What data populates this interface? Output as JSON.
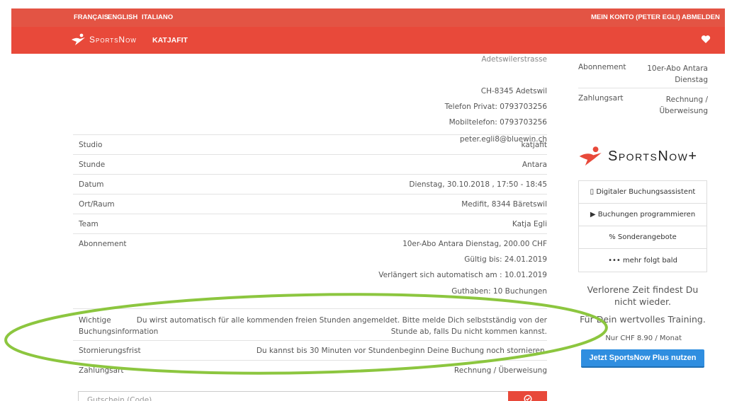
{
  "topbar": {
    "lang_fr": "FRANÇAIS",
    "lang_en": "ENGLISH",
    "lang_it": "ITALIANO",
    "account": "MEIN KONTO (PETER EGLI)",
    "logout": "ABMELDEN"
  },
  "navbar": {
    "brand": "SportsNow",
    "studio": "KATJAFIT"
  },
  "address": {
    "street": "Adetswilerstrasse",
    "city": "CH-8345 Adetswil",
    "phone_private": "Telefon Privat: 0793703256",
    "phone_mobile": "Mobiltelefon: 0793703256",
    "email": "peter.egli8@bluewin.ch"
  },
  "details": {
    "studio_label": "Studio",
    "studio_value": "katjafit",
    "lesson_label": "Stunde",
    "lesson_value": "Antara",
    "date_label": "Datum",
    "date_value": "Dienstag, 30.10.2018 , 17:50 - 18:45",
    "room_label": "Ort/Raum",
    "room_value": "Medifit, 8344 Bäretswil",
    "team_label": "Team",
    "team_value": "Katja Egli",
    "sub_label": "Abonnement",
    "sub_value": "10er-Abo Antara Dienstag, 200.00 CHF",
    "sub_valid": "Gültig bis: 24.01.2019",
    "sub_renew": "Verlängert sich automatisch am : 10.01.2019",
    "sub_credit": "Guthaben: 10 Buchungen",
    "info_label_1": "Wichtige",
    "info_label_2": "Buchungsinformation",
    "info_value_1": "Du wirst automatisch für alle kommenden freien Stunden angemeldet. Bitte melde Dich selbstständig von der",
    "info_value_2": "Stunde ab, falls Du nicht kommen kannst.",
    "cancel_label": "Stornierungsfrist",
    "cancel_value": "Du kannst bis 30 Minuten vor Stundenbeginn Deine Buchung noch stornieren.",
    "payment_label": "Zahlungsart",
    "payment_value": "Rechnung / Überweisung"
  },
  "voucher": {
    "placeholder": "Gutschein (Code)"
  },
  "sidebar": {
    "sub_label": "Abonnement",
    "sub_value_1": "10er-Abo Antara",
    "sub_value_2": "Dienstag",
    "payment_label": "Zahlungsart",
    "payment_value_1": "Rechnung /",
    "payment_value_2": "Überweisung"
  },
  "plus": {
    "brand": "SportsNow+",
    "features": [
      "▯ Digitaler Buchungsassistent",
      "▶ Buchungen programmieren",
      "% Sonderangebote",
      "••• mehr folgt bald"
    ],
    "promo_1": "Verlorene Zeit findest Du nicht wieder.",
    "promo_2": "Für Dein wertvolles Training.",
    "price": "Nur CHF 8.90 / Monat",
    "cta": "Jetzt SportsNow Plus nutzen"
  },
  "colors": {
    "brand_red": "#e8493a",
    "cta_blue": "#2f8ee0",
    "highlight_green": "#8cc63f"
  }
}
